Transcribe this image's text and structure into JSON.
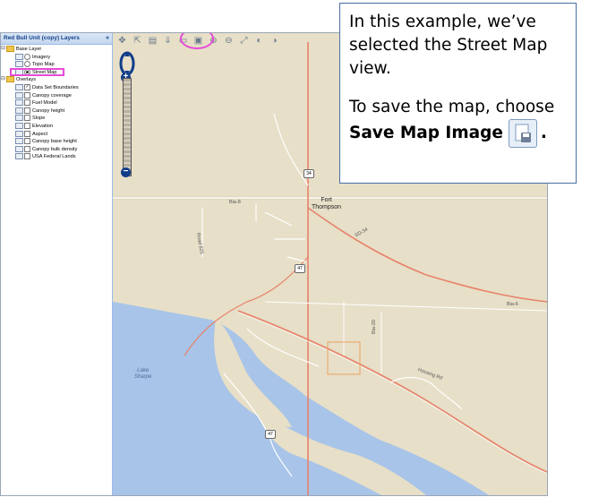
{
  "panel": {
    "title": "Red Bull Unit (copy) Layers",
    "collapse_glyph": "«",
    "base_layer_label": "Base Layer",
    "base_layers": [
      {
        "label": "Imagery",
        "selected": false
      },
      {
        "label": "Topo Map",
        "selected": false
      },
      {
        "label": "Street Map",
        "selected": true
      }
    ],
    "overlays_label": "Overlays",
    "overlays": [
      {
        "label": "Data Set Boundaries",
        "checked": true
      },
      {
        "label": "Canopy coverage",
        "checked": false
      },
      {
        "label": "Fuel Model",
        "checked": false
      },
      {
        "label": "Canopy height",
        "checked": false
      },
      {
        "label": "Slope",
        "checked": false
      },
      {
        "label": "Elevation",
        "checked": false
      },
      {
        "label": "Aspect",
        "checked": false
      },
      {
        "label": "Canopy base height",
        "checked": false
      },
      {
        "label": "Canopy bulk density",
        "checked": false
      },
      {
        "label": "USA Federal Lands",
        "checked": false
      }
    ]
  },
  "toolbar": {
    "icons": [
      "pan-icon",
      "select-icon",
      "identify-icon",
      "download-icon",
      "print-icon",
      "save-map-image-icon",
      "zoom-in-icon",
      "zoom-out-icon",
      "zoom-extent-icon",
      "previous-extent-icon",
      "next-extent-icon"
    ]
  },
  "zoom": {
    "plus": "+",
    "minus": "−"
  },
  "map": {
    "town": "Fort\nThompson",
    "road_labels": {
      "bia8": "Bia-8",
      "sd34": "SD-34",
      "bia6": "Bia-6",
      "bia20": "Bia-20",
      "road825": "Road 825",
      "housing": "Housing Rd"
    },
    "shields": {
      "s34": "34",
      "s47a": "47",
      "s47b": "47"
    },
    "lake": "Lake\nSharpe"
  },
  "callout": {
    "line1": "In this example, we’ve selected the Street Map view.",
    "line2_prefix": "To save the map, choose ",
    "line2_bold": "Save Map Image",
    "line2_suffix": "."
  },
  "colors": {
    "highlight": "#e64ad8",
    "map_land": "#e7dfc8",
    "water": "#a8c4e8",
    "road": "#e8826a"
  }
}
